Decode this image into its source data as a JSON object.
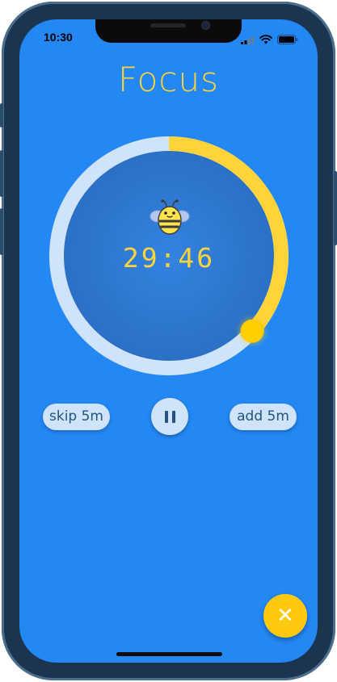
{
  "status_bar": {
    "time": "10:30"
  },
  "title": "Focus",
  "timer": {
    "display": "29:46",
    "progress_remaining": 0.367
  },
  "controls": {
    "skip_label": "skip 5m",
    "add_label": "add 5m"
  },
  "fab": {
    "symbol": "✕"
  },
  "colors": {
    "background": "#2387f4",
    "accent": "#ffd43a",
    "track": "#cfe4fb",
    "dial": "#2a6fc4"
  },
  "icons": {
    "bee": "bee-icon",
    "pause": "pause-icon",
    "close": "close-icon"
  }
}
